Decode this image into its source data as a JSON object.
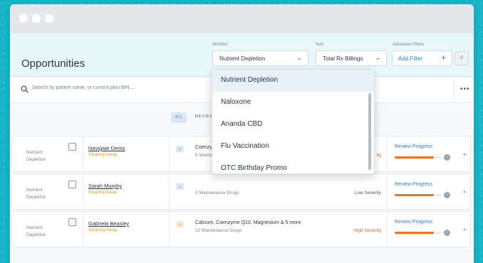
{
  "window": {
    "dot_color": "#ffffff"
  },
  "header": {
    "title": "Opportunities",
    "worklist": {
      "label": "Worklist",
      "value": "Nutrient Depletion"
    },
    "sort": {
      "label": "Sort",
      "value": "Total Rx Billings"
    },
    "advanced_filters": {
      "label": "Advanced Filters",
      "button": "Add Filter",
      "count": "0"
    }
  },
  "search": {
    "placeholder": "Search by patient name, or current plan BIN ..."
  },
  "tabs": {
    "all": "ALL",
    "review": "REVIEW"
  },
  "worklist_dropdown": {
    "options": [
      "Nutrient Depletion",
      "Naloxone",
      "Ananda CBD",
      "Flu Vaccination",
      "OTC Birthday Promo"
    ],
    "selected_index": 0
  },
  "rows": [
    {
      "worklist": "Nutrient Depletion",
      "name": "Navigate Demo",
      "status": "Slipping Away",
      "badge": "1",
      "drugs_title": "Coenzy",
      "drugs_sub": "5 Mainte",
      "severity": "ity",
      "severity_color": "#e8621a",
      "review": "Review Progress",
      "progress": 0.85
    },
    {
      "worklist": "Nutrient Depletion",
      "name": "Sarah Murphy",
      "status": "Slipping Away",
      "badge": "1",
      "drugs_title": "",
      "drugs_sub": "0 Maintenance Drugs",
      "severity": "Low Severity",
      "severity_color": "#4a5560",
      "review": "Review Progress",
      "progress": 0.85
    },
    {
      "worklist": "Nutrient Depletion",
      "name": "Gabriela Beasley",
      "status": "Slipping Away",
      "badge": "III",
      "drugs_title": "Calcium, Coenzyme Q10, Magnesium & 5 more",
      "drugs_sub": "12 Maintenance Drugs",
      "severity": "High Severity",
      "severity_color": "#e8621a",
      "review": "Review Progress",
      "progress": 0.85
    }
  ],
  "colors": {
    "accent": "#2b7fd1",
    "status_orange": "#e8941a",
    "progress": "#f07020",
    "background": "#17b3c6"
  }
}
